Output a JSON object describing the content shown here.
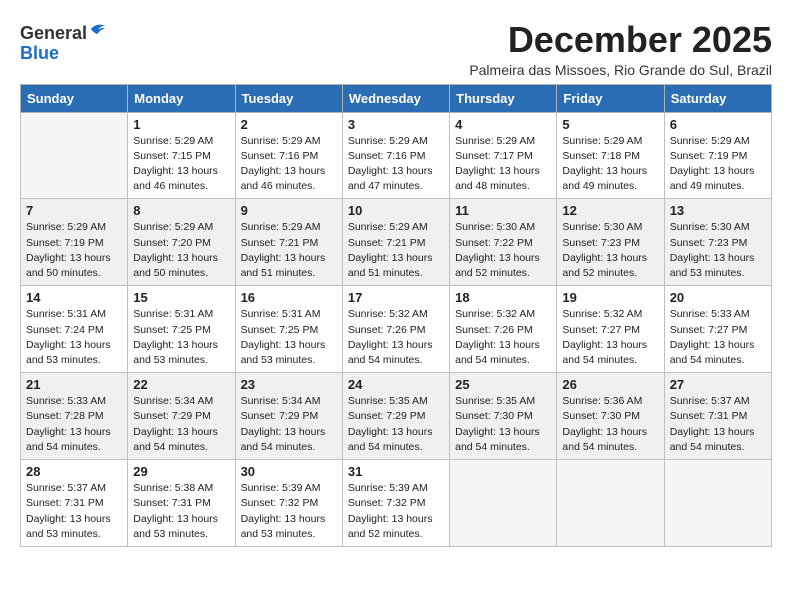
{
  "header": {
    "logo_line1": "General",
    "logo_line2": "Blue",
    "month_title": "December 2025",
    "subtitle": "Palmeira das Missoes, Rio Grande do Sul, Brazil"
  },
  "weekdays": [
    "Sunday",
    "Monday",
    "Tuesday",
    "Wednesday",
    "Thursday",
    "Friday",
    "Saturday"
  ],
  "weeks": [
    [
      {
        "day": "",
        "info": ""
      },
      {
        "day": "1",
        "info": "Sunrise: 5:29 AM\nSunset: 7:15 PM\nDaylight: 13 hours\nand 46 minutes."
      },
      {
        "day": "2",
        "info": "Sunrise: 5:29 AM\nSunset: 7:16 PM\nDaylight: 13 hours\nand 46 minutes."
      },
      {
        "day": "3",
        "info": "Sunrise: 5:29 AM\nSunset: 7:16 PM\nDaylight: 13 hours\nand 47 minutes."
      },
      {
        "day": "4",
        "info": "Sunrise: 5:29 AM\nSunset: 7:17 PM\nDaylight: 13 hours\nand 48 minutes."
      },
      {
        "day": "5",
        "info": "Sunrise: 5:29 AM\nSunset: 7:18 PM\nDaylight: 13 hours\nand 49 minutes."
      },
      {
        "day": "6",
        "info": "Sunrise: 5:29 AM\nSunset: 7:19 PM\nDaylight: 13 hours\nand 49 minutes."
      }
    ],
    [
      {
        "day": "7",
        "info": "Sunrise: 5:29 AM\nSunset: 7:19 PM\nDaylight: 13 hours\nand 50 minutes."
      },
      {
        "day": "8",
        "info": "Sunrise: 5:29 AM\nSunset: 7:20 PM\nDaylight: 13 hours\nand 50 minutes."
      },
      {
        "day": "9",
        "info": "Sunrise: 5:29 AM\nSunset: 7:21 PM\nDaylight: 13 hours\nand 51 minutes."
      },
      {
        "day": "10",
        "info": "Sunrise: 5:29 AM\nSunset: 7:21 PM\nDaylight: 13 hours\nand 51 minutes."
      },
      {
        "day": "11",
        "info": "Sunrise: 5:30 AM\nSunset: 7:22 PM\nDaylight: 13 hours\nand 52 minutes."
      },
      {
        "day": "12",
        "info": "Sunrise: 5:30 AM\nSunset: 7:23 PM\nDaylight: 13 hours\nand 52 minutes."
      },
      {
        "day": "13",
        "info": "Sunrise: 5:30 AM\nSunset: 7:23 PM\nDaylight: 13 hours\nand 53 minutes."
      }
    ],
    [
      {
        "day": "14",
        "info": "Sunrise: 5:31 AM\nSunset: 7:24 PM\nDaylight: 13 hours\nand 53 minutes."
      },
      {
        "day": "15",
        "info": "Sunrise: 5:31 AM\nSunset: 7:25 PM\nDaylight: 13 hours\nand 53 minutes."
      },
      {
        "day": "16",
        "info": "Sunrise: 5:31 AM\nSunset: 7:25 PM\nDaylight: 13 hours\nand 53 minutes."
      },
      {
        "day": "17",
        "info": "Sunrise: 5:32 AM\nSunset: 7:26 PM\nDaylight: 13 hours\nand 54 minutes."
      },
      {
        "day": "18",
        "info": "Sunrise: 5:32 AM\nSunset: 7:26 PM\nDaylight: 13 hours\nand 54 minutes."
      },
      {
        "day": "19",
        "info": "Sunrise: 5:32 AM\nSunset: 7:27 PM\nDaylight: 13 hours\nand 54 minutes."
      },
      {
        "day": "20",
        "info": "Sunrise: 5:33 AM\nSunset: 7:27 PM\nDaylight: 13 hours\nand 54 minutes."
      }
    ],
    [
      {
        "day": "21",
        "info": "Sunrise: 5:33 AM\nSunset: 7:28 PM\nDaylight: 13 hours\nand 54 minutes."
      },
      {
        "day": "22",
        "info": "Sunrise: 5:34 AM\nSunset: 7:29 PM\nDaylight: 13 hours\nand 54 minutes."
      },
      {
        "day": "23",
        "info": "Sunrise: 5:34 AM\nSunset: 7:29 PM\nDaylight: 13 hours\nand 54 minutes."
      },
      {
        "day": "24",
        "info": "Sunrise: 5:35 AM\nSunset: 7:29 PM\nDaylight: 13 hours\nand 54 minutes."
      },
      {
        "day": "25",
        "info": "Sunrise: 5:35 AM\nSunset: 7:30 PM\nDaylight: 13 hours\nand 54 minutes."
      },
      {
        "day": "26",
        "info": "Sunrise: 5:36 AM\nSunset: 7:30 PM\nDaylight: 13 hours\nand 54 minutes."
      },
      {
        "day": "27",
        "info": "Sunrise: 5:37 AM\nSunset: 7:31 PM\nDaylight: 13 hours\nand 54 minutes."
      }
    ],
    [
      {
        "day": "28",
        "info": "Sunrise: 5:37 AM\nSunset: 7:31 PM\nDaylight: 13 hours\nand 53 minutes."
      },
      {
        "day": "29",
        "info": "Sunrise: 5:38 AM\nSunset: 7:31 PM\nDaylight: 13 hours\nand 53 minutes."
      },
      {
        "day": "30",
        "info": "Sunrise: 5:39 AM\nSunset: 7:32 PM\nDaylight: 13 hours\nand 53 minutes."
      },
      {
        "day": "31",
        "info": "Sunrise: 5:39 AM\nSunset: 7:32 PM\nDaylight: 13 hours\nand 52 minutes."
      },
      {
        "day": "",
        "info": ""
      },
      {
        "day": "",
        "info": ""
      },
      {
        "day": "",
        "info": ""
      }
    ]
  ]
}
